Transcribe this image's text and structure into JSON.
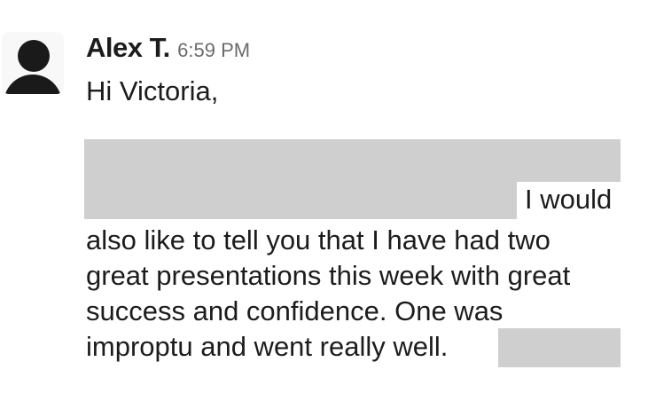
{
  "message": {
    "author": "Alex T.",
    "timestamp": "6:59 PM",
    "greeting": "Hi Victoria,",
    "lines": [
      "I would",
      "also like to tell you that I have had two",
      "great presentations this week with great",
      "success and confidence. One was",
      "improptu and went really well."
    ]
  },
  "icons": {
    "avatar": "user-silhouette-icon"
  },
  "colors": {
    "redaction": "#cfcfcf",
    "text": "#1d1c1d",
    "timestamp": "#6b6b6b"
  }
}
